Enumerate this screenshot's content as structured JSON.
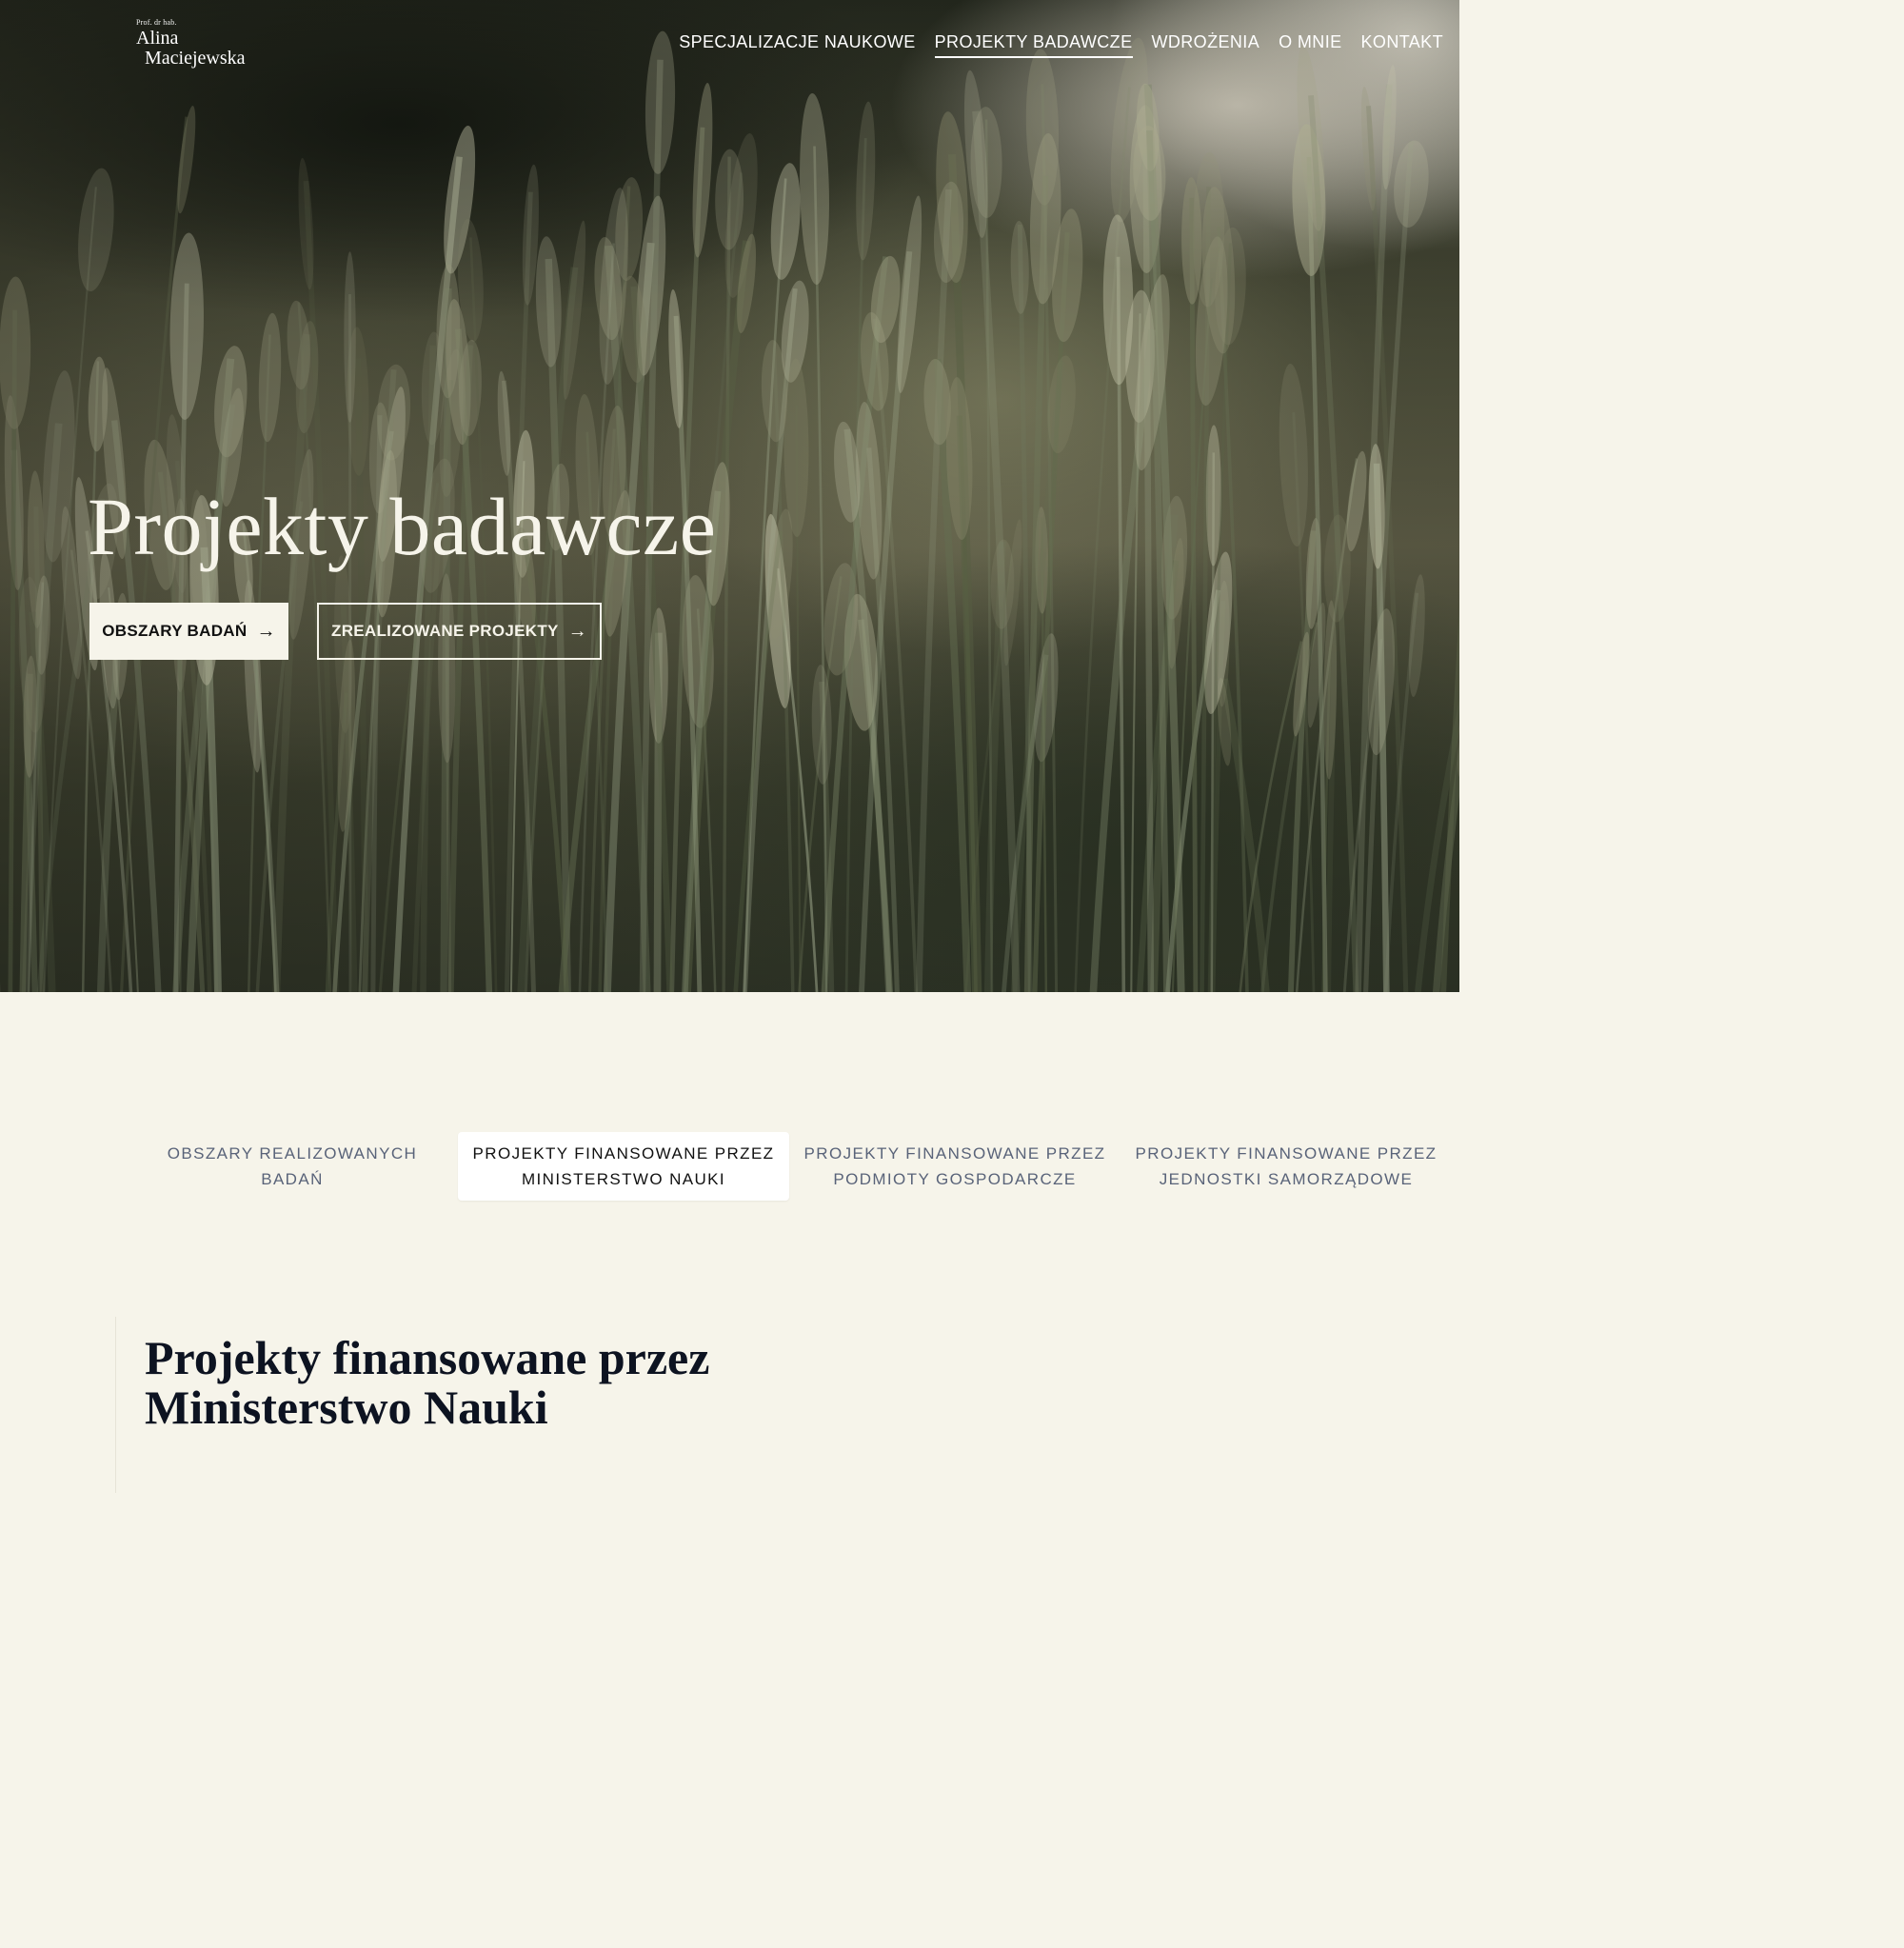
{
  "logo": {
    "title": "Prof. dr hab.",
    "first_name": "Alina",
    "last_name": "Maciejewska"
  },
  "nav": {
    "items": [
      {
        "label": "SPECJALIZACJE NAUKOWE",
        "active": false
      },
      {
        "label": "PROJEKTY BADAWCZE",
        "active": true
      },
      {
        "label": "WDROŻENIA",
        "active": false
      },
      {
        "label": "O MNIE",
        "active": false
      },
      {
        "label": "KONTAKT",
        "active": false
      }
    ]
  },
  "hero": {
    "title": "Projekty badawcze",
    "buttons": {
      "primary": {
        "label": "OBSZARY BADAŃ",
        "icon": "arrow-right-icon",
        "glyph": "→"
      },
      "secondary": {
        "label": "ZREALIZOWANE PROJEKTY",
        "icon": "arrow-right-icon",
        "glyph": "→"
      }
    }
  },
  "tabs": [
    {
      "line1": "OBSZARY REALIZOWANYCH",
      "line2": "BADAŃ",
      "active": false
    },
    {
      "line1": "PROJEKTY FINANSOWANE PRZEZ",
      "line2": "MINISTERSTWO NAUKI",
      "active": true
    },
    {
      "line1": "PROJEKTY FINANSOWANE PRZEZ",
      "line2": "PODMIOTY GOSPODARCZE",
      "active": false
    },
    {
      "line1": "PROJEKTY FINANSOWANE PRZEZ",
      "line2": "JEDNOSTKI SAMORZĄDOWE",
      "active": false
    }
  ],
  "section": {
    "title_line1": "Projekty finansowane przez",
    "title_line2": "Ministerstwo Nauki"
  },
  "colors": {
    "page_background": "#f6f4ea",
    "tab_text": "#596379",
    "heading": "#0d1321"
  }
}
